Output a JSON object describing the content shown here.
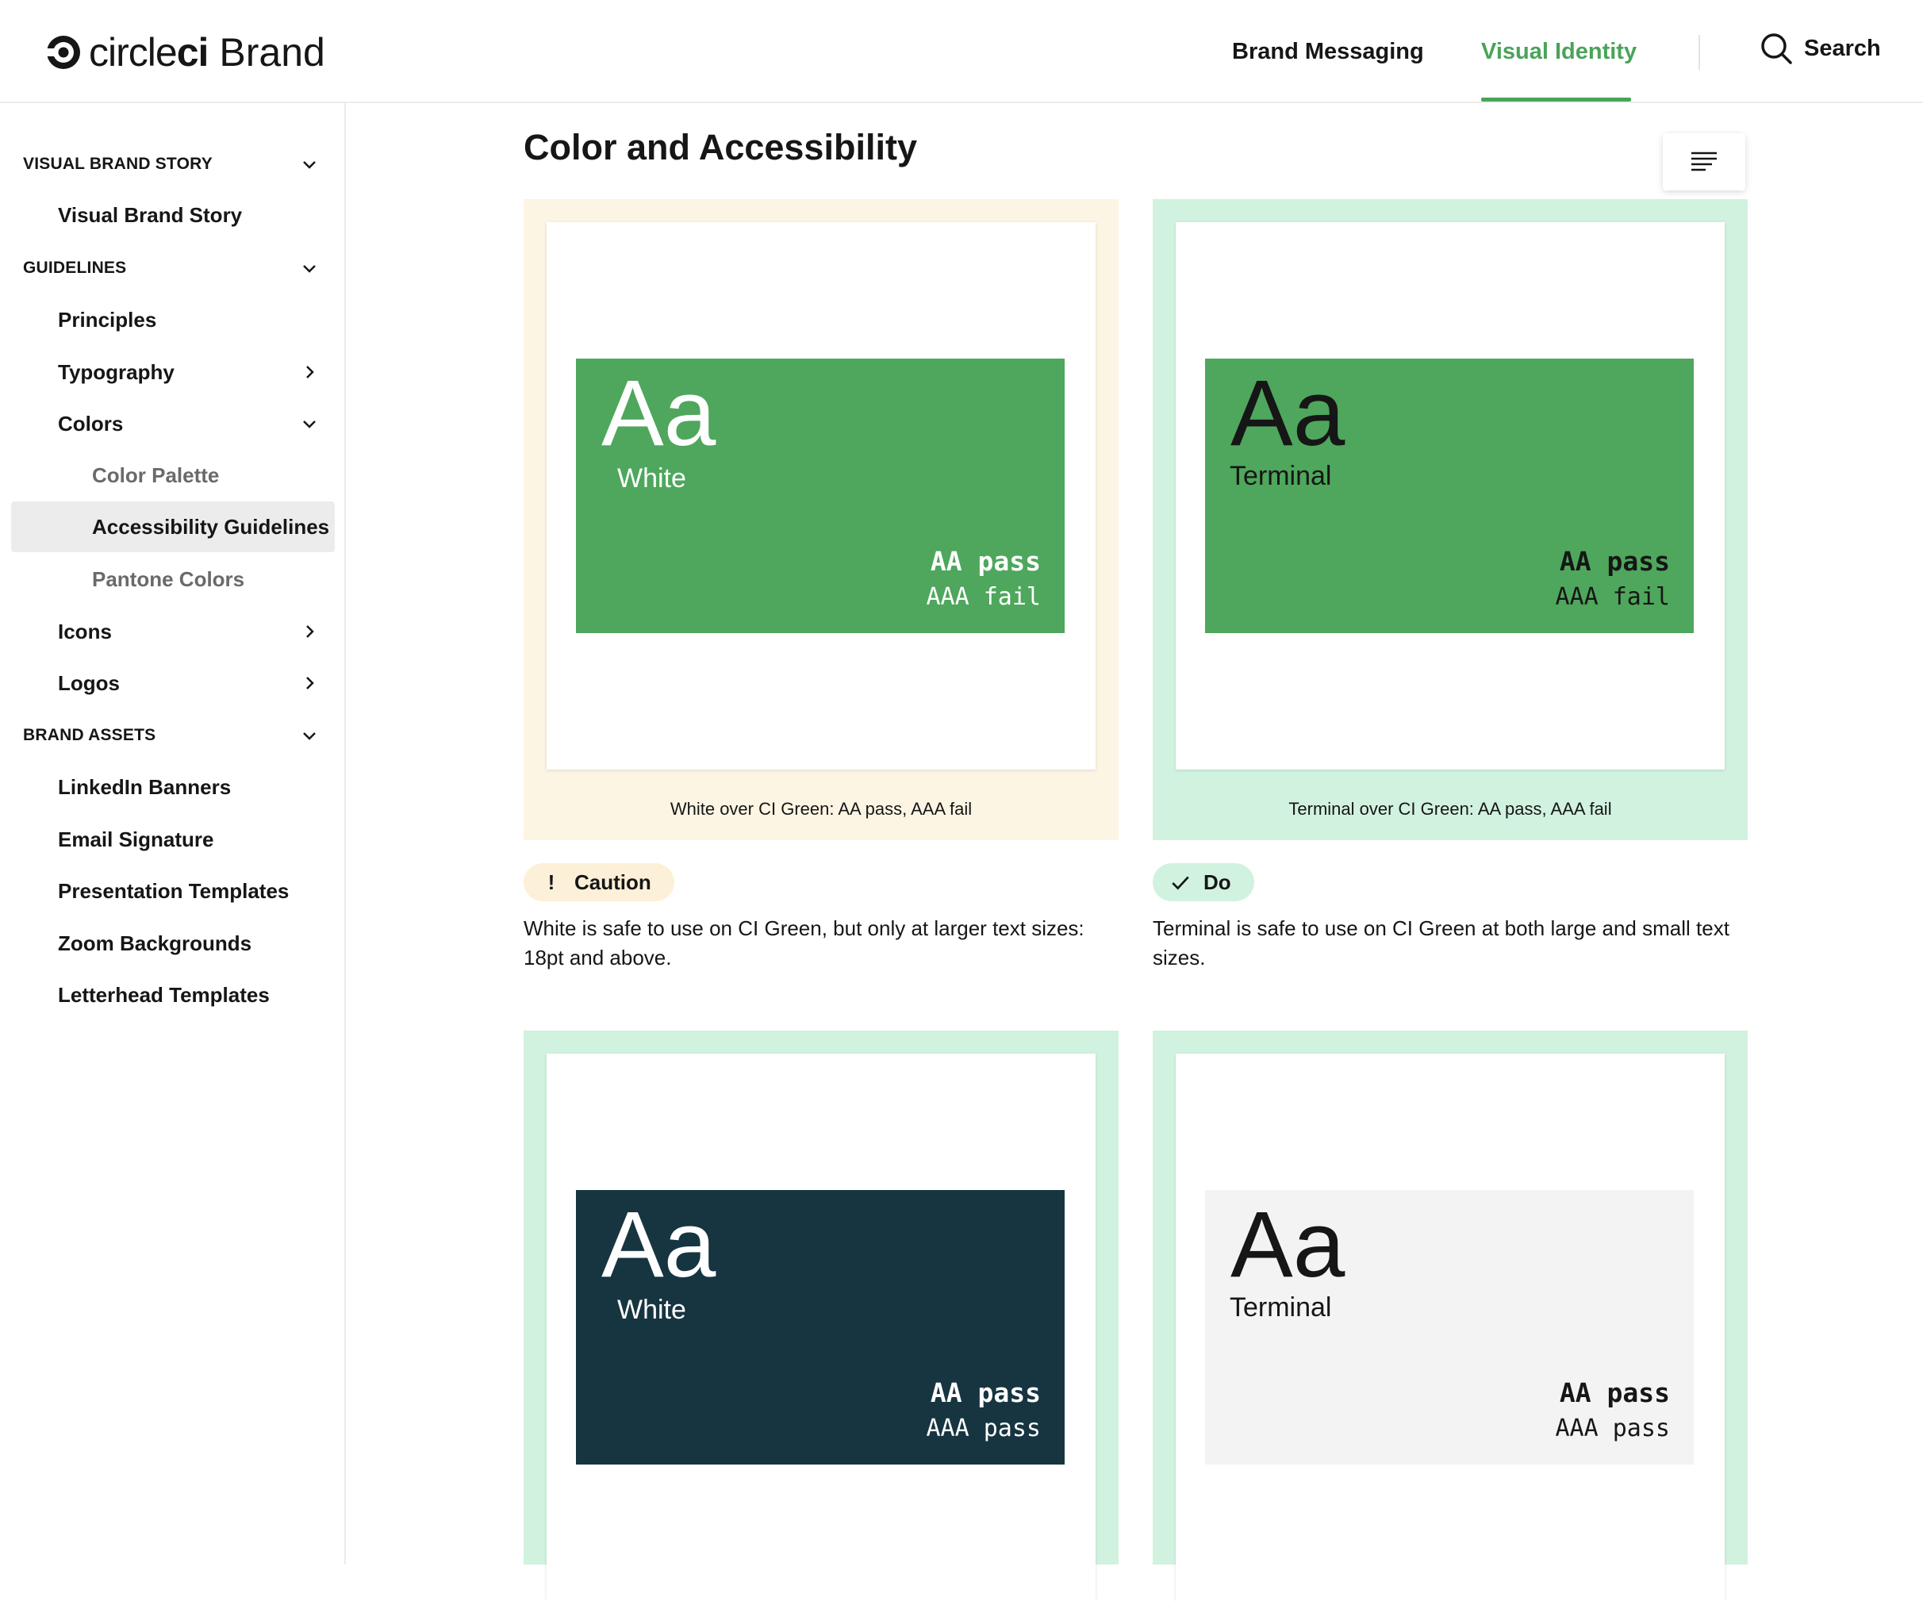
{
  "header": {
    "logo_word": "circle",
    "logo_word_bold": "ci",
    "logo_brand": "Brand",
    "nav": [
      "Brand Messaging",
      "Visual Identity"
    ],
    "active_nav": "Visual Identity",
    "search_label": "Search",
    "accent_color": "#4aa35a"
  },
  "sidebar": {
    "sections": [
      {
        "label": "VISUAL BRAND STORY",
        "expanded": true
      },
      {
        "label": "GUIDELINES",
        "expanded": true
      },
      {
        "label": "BRAND ASSETS",
        "expanded": true
      }
    ],
    "items": [
      {
        "label": "Visual Brand Story"
      },
      {
        "label": "Principles"
      },
      {
        "label": "Typography",
        "chevron": "right"
      },
      {
        "label": "Colors",
        "chevron": "down"
      },
      {
        "label": "Color Palette"
      },
      {
        "label": "Accessibility Guidelines",
        "active": true
      },
      {
        "label": "Pantone Colors"
      },
      {
        "label": "Icons",
        "chevron": "right"
      },
      {
        "label": "Logos",
        "chevron": "right"
      },
      {
        "label": "LinkedIn Banners"
      },
      {
        "label": "Email Signature"
      },
      {
        "label": "Presentation Templates"
      },
      {
        "label": "Zoom Backgrounds"
      },
      {
        "label": "Letterhead Templates"
      }
    ]
  },
  "main": {
    "title": "Color and Accessibility",
    "toc_icon": "table-of-contents-icon",
    "cards": [
      {
        "sample": "Aa",
        "label": "White",
        "grade1": "AA pass",
        "grade2": "AAA fail",
        "caption": "White over CI Green: AA pass, AAA fail",
        "frame_color": "#fdf5e3",
        "swatch_color": "#4ea75c",
        "text_color": "#ffffff",
        "badge": "Caution",
        "badge_icon": "!",
        "badge_color": "#fdf0d8",
        "description": "White is safe to use on CI Green, but only at larger text sizes: 18pt and above."
      },
      {
        "sample": "Aa",
        "label": "Terminal",
        "grade1": "AA pass",
        "grade2": "AAA fail",
        "caption": "Terminal over CI Green: AA pass, AAA fail",
        "frame_color": "#d1f2df",
        "swatch_color": "#4ea75c",
        "text_color": "#161616",
        "badge": "Do",
        "badge_icon": "check-icon",
        "badge_color": "#d1f2df",
        "description": "Terminal is safe to use on CI Green at both large and small text sizes."
      },
      {
        "sample": "Aa",
        "label": "White",
        "grade1": "AA pass",
        "grade2": "AAA pass",
        "frame_color": "#d1f2df",
        "swatch_color": "#163540",
        "text_color": "#ffffff"
      },
      {
        "sample": "Aa",
        "label": "Terminal",
        "grade1": "AA pass",
        "grade2": "AAA pass",
        "frame_color": "#d1f2df",
        "swatch_color": "#f3f3f3",
        "text_color": "#161616"
      }
    ]
  }
}
